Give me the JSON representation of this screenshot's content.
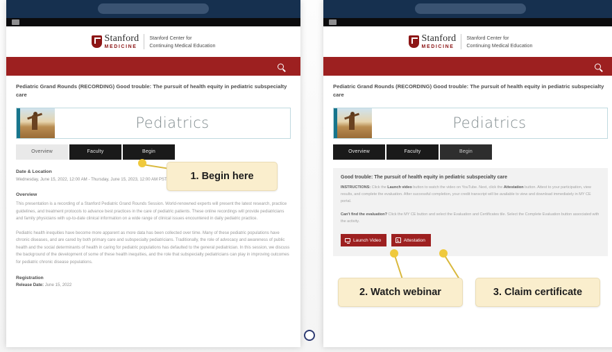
{
  "device": {
    "keyboard_icon": "keyboard-icon",
    "home_button": "home-button"
  },
  "header": {
    "logo_stanford": "Stanford",
    "logo_medicine": "MEDICINE",
    "logo_sub_line1": "Stanford Center for",
    "logo_sub_line2": "Continuing Medical Education",
    "search_icon": "search-icon"
  },
  "course": {
    "title": "Pediatric Grand Rounds (RECORDING) Good trouble: The pursuit of health equity in pediatric subspecialty care",
    "banner_title": "Pediatrics",
    "banner_image_alt": "child-silhouette-image"
  },
  "tabs": [
    {
      "label": "Overview"
    },
    {
      "label": "Faculty"
    },
    {
      "label": "Begin"
    }
  ],
  "left_panel": {
    "date_heading": "Date & Location",
    "date_value": "Wednesday, June 15, 2022, 12:00 AM - Thursday, June 15, 2023, 12:00 AM PST",
    "overview_heading": "Overview",
    "overview_p1": "This presentation is a recording of a Stanford Pediatric Grand Rounds Session.  World-renowned experts will present the latest research, practice guidelines, and treatment protocols to advance best practices in the care of pediatric patients. These online recordings will provide pediatricians and family physicians with up-to-date clinical information on a wide range of clinical issues encountered in daily pediatric practice.",
    "overview_p2": "Pediatric health inequities have become more apparent as more data has been collected over time. Many of these pediatric populations have chronic diseases, and are cared by both primary care and subspecialty pediatricians. Traditionally, the role of advocacy and awareness of public health and the social determinants of health in caring for pediatric populations has defaulted to the general pediatrician. In this session, we discuss the background of the development of some of these health inequities, and the role that subspecialty pediatricians can play in improving outcomes for pediatric chronic disease populations.",
    "registration_heading": "Registration",
    "release_label": "Release Date:",
    "release_value": "June 15, 2022"
  },
  "right_panel": {
    "begin_title": "Good trouble: The pursuit of health equity in pediatric subspecialty care",
    "instructions_label": "INSTRUCTIONS:",
    "instructions_a": " Click the ",
    "instructions_bold1": "Launch video",
    "instructions_b": " button to watch the video on YouTube. Next, click the ",
    "instructions_bold2": "Attestation",
    "instructions_c": " button. Attest to your participation, view results, and complete the evaluation. After successful completion, your credit transcript will be available to view and download immediately in MY CE portal.",
    "cant_find_label": "Can't find the evaluation?",
    "cant_find_text": " Click the MY CE button and select the Evaluation and Certificates tile. Select the Complete Evaluation button associated with the activity.",
    "launch_video_label": "Launch Video",
    "launch_video_icon": "monitor-icon",
    "attestation_label": "Attestation",
    "attestation_icon": "form-icon"
  },
  "callouts": [
    {
      "text": "1. Begin here"
    },
    {
      "text": "2. Watch webinar"
    },
    {
      "text": "3. Claim certificate"
    }
  ],
  "colors": {
    "stanford_red": "#8c1515",
    "search_bar_red": "#9d2020",
    "device_navy": "#16304f",
    "banner_teal": "#17758c",
    "callout_cream": "#faeecd",
    "callout_dot": "#efc93c"
  }
}
